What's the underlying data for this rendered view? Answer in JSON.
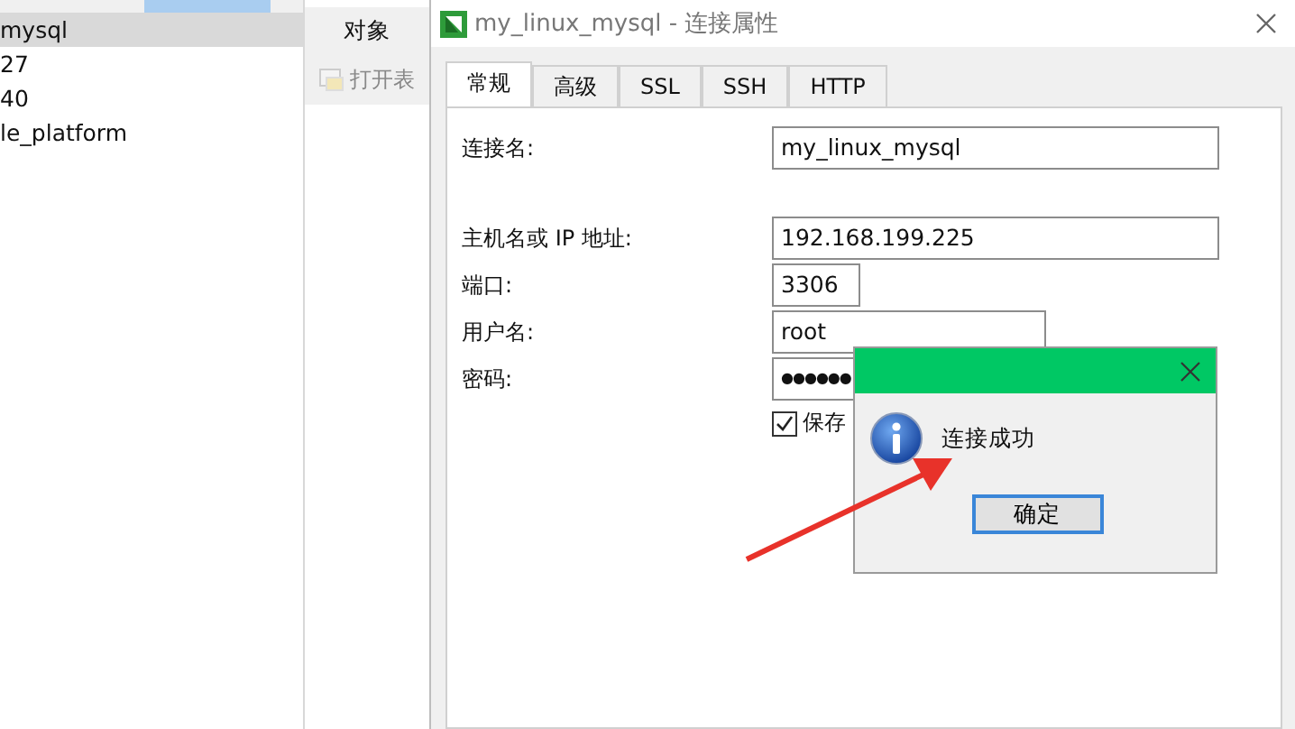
{
  "sidebar": {
    "items": [
      {
        "label": "mysql",
        "selected": true
      },
      {
        "label": "27",
        "selected": false
      },
      {
        "label": "40",
        "selected": false
      },
      {
        "label": "le_platform",
        "selected": false
      }
    ]
  },
  "object_panel": {
    "tab": "对象",
    "toolbar": [
      {
        "label": "打开表",
        "disabled": true
      }
    ]
  },
  "dialog": {
    "title": "my_linux_mysql - 连接属性",
    "tabs": [
      {
        "label": "常规",
        "selected": true
      },
      {
        "label": "高级",
        "selected": false
      },
      {
        "label": "SSL",
        "selected": false
      },
      {
        "label": "SSH",
        "selected": false
      },
      {
        "label": "HTTP",
        "selected": false
      }
    ],
    "field_groups": [
      [
        {
          "label": "连接名:",
          "value": "my_linux_mysql",
          "kind": "wide"
        }
      ],
      [
        {
          "label": "主机名或 IP 地址:",
          "value": "192.168.199.225",
          "kind": "wide"
        },
        {
          "label": "端口:",
          "value": "3306",
          "kind": "short"
        },
        {
          "label": "用户名:",
          "value": "root",
          "kind": "medium"
        },
        {
          "label": "密码:",
          "value": "●●●●●●",
          "kind": "password"
        }
      ]
    ],
    "save_password": {
      "label": "保存",
      "checked": true
    }
  },
  "message_box": {
    "message": "连接成功",
    "buttons": [
      "确定"
    ]
  }
}
